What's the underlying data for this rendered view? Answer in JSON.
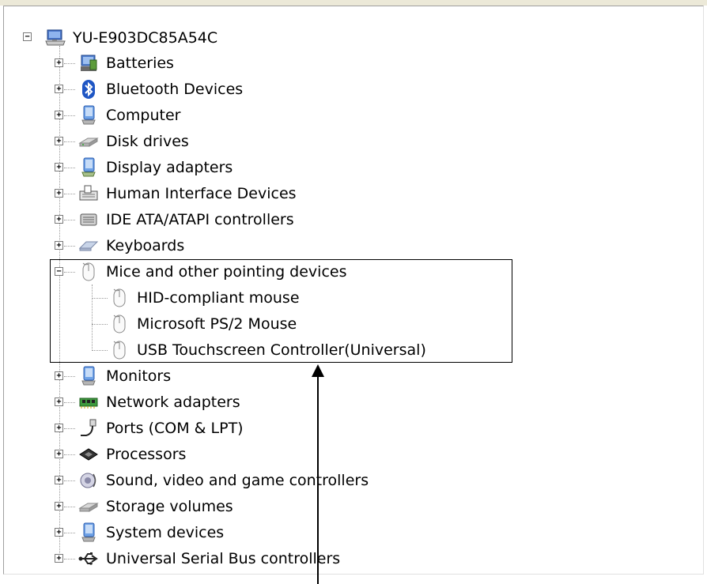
{
  "tree": {
    "root": {
      "label": "YU-E903DC85A54C",
      "icon": "computer-icon"
    },
    "categories": [
      {
        "label": "Batteries",
        "icon": "battery-icon",
        "expanded": false
      },
      {
        "label": "Bluetooth Devices",
        "icon": "bluetooth-icon",
        "expanded": false
      },
      {
        "label": "Computer",
        "icon": "computer-device-icon",
        "expanded": false
      },
      {
        "label": "Disk drives",
        "icon": "disk-drive-icon",
        "expanded": false
      },
      {
        "label": "Display adapters",
        "icon": "display-adapter-icon",
        "expanded": false
      },
      {
        "label": "Human Interface Devices",
        "icon": "hid-icon",
        "expanded": false
      },
      {
        "label": "IDE ATA/ATAPI controllers",
        "icon": "ide-controller-icon",
        "expanded": false
      },
      {
        "label": "Keyboards",
        "icon": "keyboard-icon",
        "expanded": false
      },
      {
        "label": "Mice and other pointing devices",
        "icon": "mouse-icon",
        "expanded": true,
        "children": [
          {
            "label": "HID-compliant mouse",
            "icon": "mouse-icon"
          },
          {
            "label": "Microsoft PS/2 Mouse",
            "icon": "mouse-icon"
          },
          {
            "label": "USB Touchscreen Controller(Universal)",
            "icon": "mouse-icon"
          }
        ]
      },
      {
        "label": "Monitors",
        "icon": "monitor-icon",
        "expanded": false
      },
      {
        "label": "Network adapters",
        "icon": "network-adapter-icon",
        "expanded": false
      },
      {
        "label": "Ports (COM & LPT)",
        "icon": "port-icon",
        "expanded": false
      },
      {
        "label": "Processors",
        "icon": "processor-icon",
        "expanded": false
      },
      {
        "label": "Sound, video and game controllers",
        "icon": "sound-icon",
        "expanded": false
      },
      {
        "label": "Storage volumes",
        "icon": "storage-volume-icon",
        "expanded": false
      },
      {
        "label": "System devices",
        "icon": "system-device-icon",
        "expanded": false
      },
      {
        "label": "Universal Serial Bus controllers",
        "icon": "usb-icon",
        "expanded": false
      }
    ]
  },
  "colors": {
    "highlight_box": "#000000",
    "tree_lines": "#9a9a9a"
  }
}
